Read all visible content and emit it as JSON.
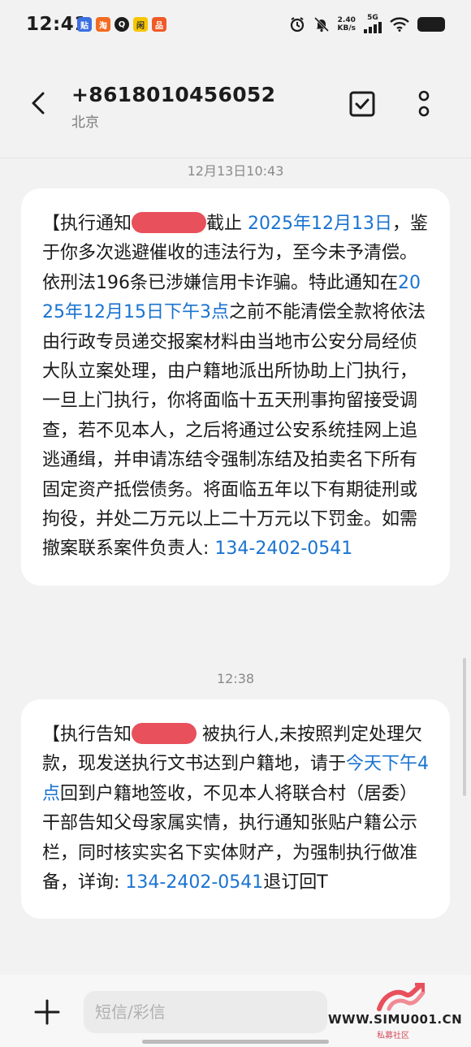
{
  "status_bar": {
    "time": "12:41",
    "net_speed_value": "2.40",
    "net_speed_unit": "KB/s",
    "network_type": "5G",
    "app_icons": [
      "baidu-tieba-icon",
      "taobao-icon",
      "qq-icon",
      "app-icon-yellow",
      "app-icon-orange"
    ]
  },
  "header": {
    "contact_number": "+8618010456052",
    "contact_location": "北京"
  },
  "messages": [
    {
      "timestamp": "12月13日10:43",
      "segments": [
        {
          "text": "【执行通知",
          "link": false
        },
        {
          "redacted": true,
          "width": 92
        },
        {
          "text": "截止 ",
          "link": false
        },
        {
          "text": "2025年12月13日",
          "link": true
        },
        {
          "text": "，鉴于你多次逃避催收的违法行为，至今未予清偿。依刑法196条已涉嫌信用卡诈骗。特此通知在",
          "link": false
        },
        {
          "text": "2025年12月15日下午3点",
          "link": true
        },
        {
          "text": "之前不能清偿全款将依法由行政专员递交报案材料由当地市公安分局经侦大队立案处理，由户籍地派出所协助上门执行，一旦上门执行，你将面临十五天刑事拘留接受调查，若不见本人，之后将通过公安系统挂网上追逃通缉，并申请冻结令强制冻结及拍卖名下所有固定资产抵偿债务。将面临五年以下有期徒刑或拘役，并处二万元以上二十万元以下罚金。如需撤案联系案件负责人: ",
          "link": false
        },
        {
          "text": "134-2402-0541",
          "link": true
        }
      ]
    },
    {
      "timestamp": "12:38",
      "segments": [
        {
          "text": "【执行告知",
          "link": false
        },
        {
          "redacted": true,
          "width": 80
        },
        {
          "text": " 被执行人,未按照判定处理欠款，现发送执行文书达到户籍地，请于",
          "link": false
        },
        {
          "text": "今天下午4点",
          "link": true
        },
        {
          "text": "回到户籍地签收，不见本人将联合村（居委）干部告知父母家属实情，执行通知张贴户籍公示栏，同时核实实名下实体财产，为强制执行做准备，详询: ",
          "link": false
        },
        {
          "text": "134-2402-0541",
          "link": true
        },
        {
          "text": "退订回T",
          "link": false
        }
      ]
    }
  ],
  "input": {
    "placeholder": "短信/彩信"
  },
  "watermark": {
    "text": "WWW.SIMU001.CN",
    "subtext": "私募社区"
  },
  "colors": {
    "link": "#1a73d1",
    "background": "#f2f2f2",
    "bubble": "#ffffff",
    "redaction": "#e8505b"
  }
}
